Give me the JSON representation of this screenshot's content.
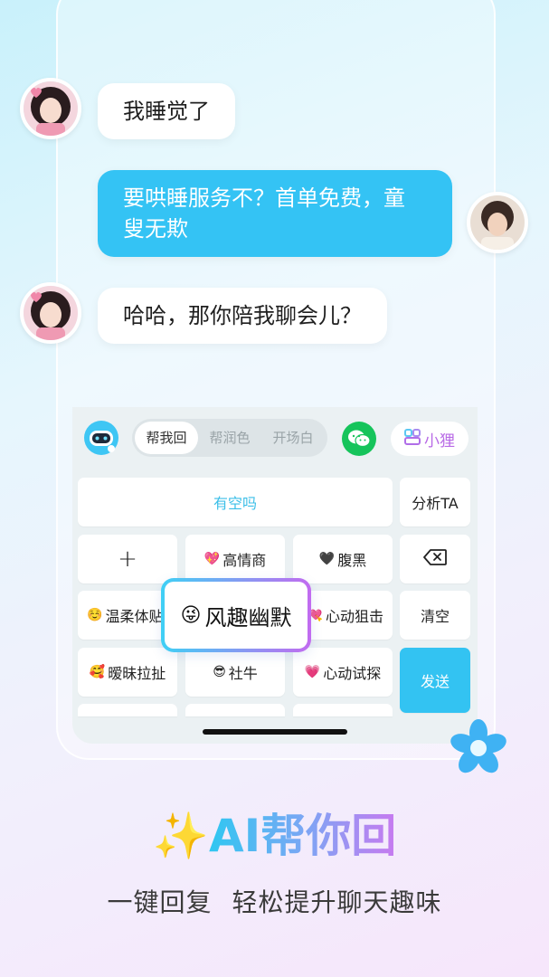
{
  "chat": {
    "messages": [
      {
        "sender": "her",
        "text": "我睡觉了"
      },
      {
        "sender": "me",
        "text_line1": "要哄睡服务不？首单免费，童",
        "text_line2": "叟无欺"
      },
      {
        "sender": "her",
        "text": "哈哈，那你陪我聊会儿？"
      }
    ]
  },
  "keyboard": {
    "tabs": [
      "帮我回",
      "帮润色",
      "开场白"
    ],
    "active_tab": "帮我回",
    "xiaoli_label": "小狸",
    "suggestion": "有空吗",
    "analyze_label": "分析TA",
    "plus_label": "+",
    "clear_label": "清空",
    "send_label": "发送",
    "styles": {
      "gaoqingshang": {
        "emoji": "💖",
        "label": "高情商"
      },
      "fuhei": {
        "emoji": "🖤",
        "label": "腹黑"
      },
      "wenrou": {
        "emoji": "☺️",
        "label": "温柔体贴"
      },
      "xindongjuji": {
        "emoji": "💘",
        "label": "心动狙击"
      },
      "aimei": {
        "emoji": "🥰",
        "label": "暧昧拉扯"
      },
      "sheniu": {
        "emoji": "😎",
        "label": "社牛"
      },
      "xindongshitan": {
        "emoji": "💗",
        "label": "心动试探"
      }
    },
    "popup": {
      "emoji": "😜",
      "label": "风趣幽默"
    }
  },
  "promo": {
    "sparkle": "✨",
    "headline": "AI帮你回",
    "subline": "一键回复 轻松提升聊天趣味"
  },
  "colors": {
    "accent_blue": "#34c3f4",
    "accent_purple": "#c77af0",
    "wechat_green": "#16c45b"
  }
}
